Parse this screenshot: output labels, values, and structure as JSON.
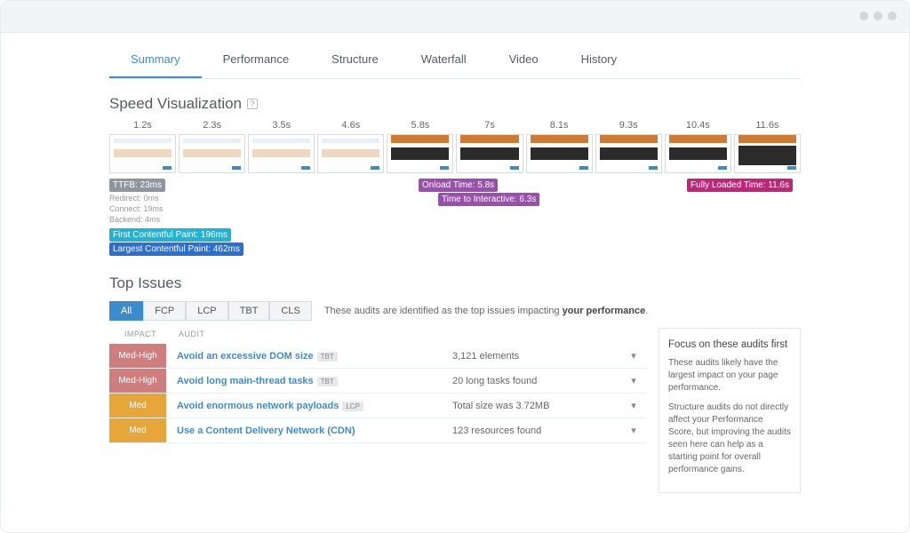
{
  "tabs": [
    "Summary",
    "Performance",
    "Structure",
    "Waterfall",
    "Video",
    "History"
  ],
  "active_tab_index": 0,
  "speed_viz": {
    "title": "Speed Visualization",
    "help": "?",
    "frames": [
      {
        "time": "1.2s",
        "mode": "light"
      },
      {
        "time": "2.3s",
        "mode": "light"
      },
      {
        "time": "3.5s",
        "mode": "light"
      },
      {
        "time": "4.6s",
        "mode": "light"
      },
      {
        "time": "5.8s",
        "mode": "mid"
      },
      {
        "time": "7s",
        "mode": "mid"
      },
      {
        "time": "8.1s",
        "mode": "mid"
      },
      {
        "time": "9.3s",
        "mode": "mid"
      },
      {
        "time": "10.4s",
        "mode": "mid"
      },
      {
        "time": "11.6s",
        "mode": "full"
      }
    ],
    "markers": {
      "ttfb": "TTFB: 23ms",
      "sub": [
        "Redirect: 0ms",
        "Connect: 19ms",
        "Backend: 4ms"
      ],
      "fcp": "First Contentful Paint: 196ms",
      "lcp": "Largest Contentful Paint: 462ms",
      "onload": "Onload Time: 5.8s",
      "tti": "Time to Interactive: 6.3s",
      "fully_loaded": "Fully Loaded Time: 11.6s"
    }
  },
  "top_issues": {
    "title": "Top Issues",
    "filters": [
      "All",
      "FCP",
      "LCP",
      "TBT",
      "CLS"
    ],
    "active_filter_index": 0,
    "filter_note_prefix": "These audits are identified as the top issues impacting ",
    "filter_note_strong": "your performance",
    "filter_note_suffix": ".",
    "headers": {
      "impact": "Impact",
      "audit": "Audit"
    },
    "rows": [
      {
        "impact": "Med-High",
        "impact_class": "medhigh",
        "audit": "Avoid an excessive DOM size",
        "tag": "TBT",
        "value": "3,121 elements"
      },
      {
        "impact": "Med-High",
        "impact_class": "medhigh",
        "audit": "Avoid long main-thread tasks",
        "tag": "TBT",
        "value": "20 long tasks found"
      },
      {
        "impact": "Med",
        "impact_class": "med",
        "audit": "Avoid enormous network payloads",
        "tag": "LCP",
        "value": "Total size was 3.72MB"
      },
      {
        "impact": "Med",
        "impact_class": "med",
        "audit": "Use a Content Delivery Network (CDN)",
        "tag": "",
        "value": "123 resources found"
      }
    ],
    "aside": {
      "title": "Focus on these audits first",
      "p1": "These audits likely have the largest impact on your page performance.",
      "p2": "Structure audits do not directly affect your Performance Score, but improving the audits seen here can help as a starting point for overall performance gains."
    }
  }
}
